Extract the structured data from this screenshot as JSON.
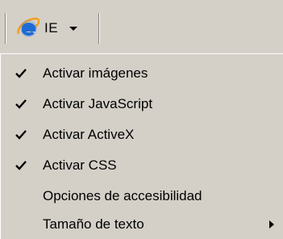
{
  "toolbar": {
    "button_label": "IE",
    "button_icon": "ie-logo-icon",
    "dropdown_icon": "chevron-down-icon"
  },
  "menu": {
    "items": [
      {
        "label": "Activar imágenes",
        "checked": true
      },
      {
        "label": "Activar JavaScript",
        "checked": true
      },
      {
        "label": "Activar ActiveX",
        "checked": true
      },
      {
        "label": "Activar CSS",
        "checked": true
      },
      {
        "label": "Opciones de accesibilidad",
        "checked": false
      },
      {
        "label": "Tamaño de texto",
        "checked": false,
        "submenu": true
      }
    ]
  },
  "colors": {
    "face": "#d4d0c8",
    "ie_blue": "#1e6bd6",
    "ie_orange": "#f0a020"
  }
}
